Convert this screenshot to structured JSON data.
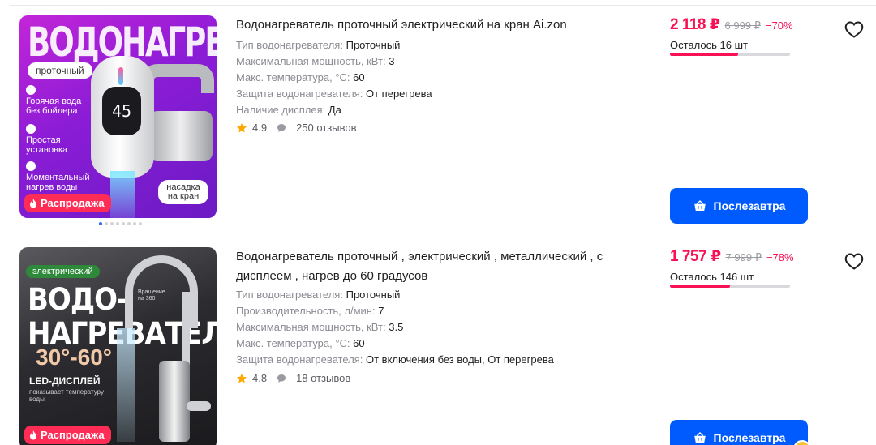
{
  "products": [
    {
      "title": "Водонагреватель проточный электрический на кран Ai.zon",
      "image": {
        "headline": "ВОДОНАГРЕВАТЕЛЬ",
        "type_chip": "проточный",
        "features": [
          "Горячая вода без бойлера",
          "Простая установка",
          "Моментальный нагрев воды"
        ],
        "display_value": "45",
        "nozzle_chip": "насадка на кран",
        "sale_badge": "Распродажа",
        "dots": 8,
        "active_dot": 0
      },
      "specs": [
        {
          "key": "Тип водонагревателя:",
          "value": "Проточный"
        },
        {
          "key": "Максимальная мощность, кВт:",
          "value": "3"
        },
        {
          "key": "Макс. температура, °C:",
          "value": "60"
        },
        {
          "key": "Защита водонагревателя:",
          "value": "От перегрева"
        },
        {
          "key": "Наличие дисплея:",
          "value": "Да"
        }
      ],
      "rating": "4.9",
      "reviews": "250 отзывов",
      "price": "2 118 ₽",
      "old_price": "6 999 ₽",
      "discount": "−70%",
      "stock": "Осталось 16 шт",
      "stock_fraction": 0.57,
      "buy_label": "Послезавтра"
    },
    {
      "title": "Водонагреватель проточный , электрический , металлический , с дисплеем , нагрев до 60 градусов",
      "image": {
        "type_chip": "электрический",
        "headline_line1": "ВОДО-",
        "headline_line2": "НАГРЕВАТЕЛЬ",
        "temp": "30°-60°",
        "rotate_tag": "Вращение на 360",
        "led_title": "LED-ДИСПЛЕЙ",
        "led_sub": "показывает температуру воды",
        "sale_badge": "Распродажа"
      },
      "specs": [
        {
          "key": "Тип водонагревателя:",
          "value": "Проточный"
        },
        {
          "key": "Производительность, л/мин:",
          "value": "7"
        },
        {
          "key": "Максимальная мощность, кВт:",
          "value": "3.5"
        },
        {
          "key": "Макс. температура, °C:",
          "value": "60"
        },
        {
          "key": "Защита водонагревателя:",
          "value": "От включения без воды, От перегрева"
        }
      ],
      "rating": "4.8",
      "reviews": "18 отзывов",
      "price": "1 757 ₽",
      "old_price": "7 999 ₽",
      "discount": "−78%",
      "stock": "Осталось 146 шт",
      "stock_fraction": 0.5,
      "buy_label": "Послезавтра"
    }
  ],
  "colors": {
    "accent": "#005bff",
    "price": "#f91155",
    "star": "#ffa800"
  },
  "icons": {
    "favorite": "heart-outline-icon",
    "cart": "basket-icon",
    "star": "star-icon",
    "reviews": "speech-bubble-icon",
    "sale": "fire-icon"
  }
}
